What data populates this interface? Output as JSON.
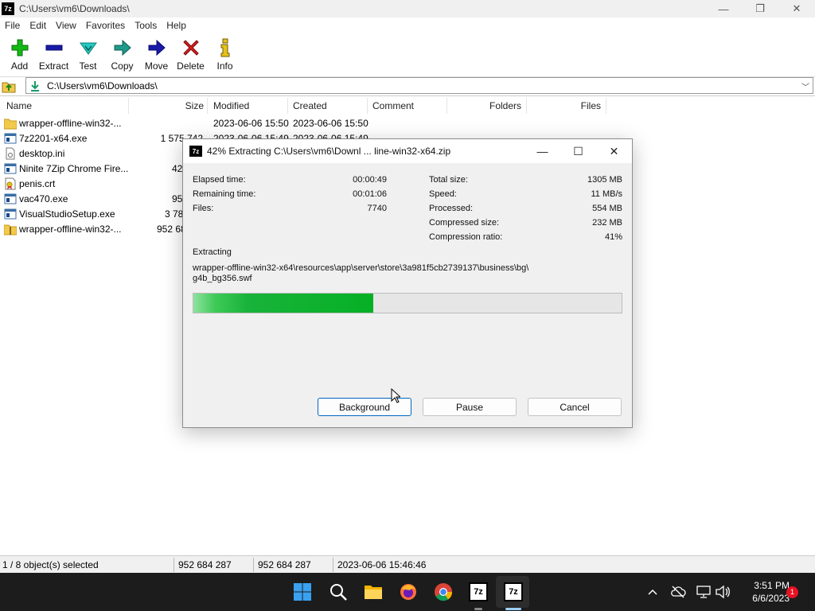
{
  "window": {
    "title": "C:\\Users\\vm6\\Downloads\\",
    "app_icon": "7z",
    "minimize": "—",
    "maximize": "❐",
    "close": "✕"
  },
  "menu": [
    "File",
    "Edit",
    "View",
    "Favorites",
    "Tools",
    "Help"
  ],
  "toolbar": {
    "add": "Add",
    "extract": "Extract",
    "test": "Test",
    "copy": "Copy",
    "move": "Move",
    "delete": "Delete",
    "info": "Info"
  },
  "address": {
    "path": "C:\\Users\\vm6\\Downloads\\"
  },
  "columns": {
    "name": "Name",
    "size": "Size",
    "modified": "Modified",
    "created": "Created",
    "comment": "Comment",
    "folders": "Folders",
    "files": "Files"
  },
  "files": [
    {
      "name": "wrapper-offline-win32-...",
      "size": "",
      "modified": "2023-06-06 15:50",
      "created": "2023-06-06 15:50",
      "icon": "folder-icon"
    },
    {
      "name": "7z2201-x64.exe",
      "size": "1 575 742",
      "modified": "2023-06-06 15:49",
      "created": "2023-06-06 15:49",
      "icon": "exe-icon"
    },
    {
      "name": "desktop.ini",
      "size": "",
      "modified": "",
      "created": "",
      "icon": "ini-icon"
    },
    {
      "name": "Ninite 7Zip Chrome Fire...",
      "size": "42",
      "modified": "",
      "created": "",
      "icon": "exe-icon"
    },
    {
      "name": "penis.crt",
      "size": "",
      "modified": "",
      "created": "",
      "icon": "certificate-icon"
    },
    {
      "name": "vac470.exe",
      "size": "95",
      "modified": "",
      "created": "",
      "icon": "exe-icon"
    },
    {
      "name": "VisualStudioSetup.exe",
      "size": "3 78",
      "modified": "",
      "created": "",
      "icon": "exe-icon"
    },
    {
      "name": "wrapper-offline-win32-...",
      "size": "952 68",
      "modified": "",
      "created": "",
      "icon": "zip-folder-icon"
    }
  ],
  "status": {
    "selection": "1 / 8 object(s) selected",
    "size1": "952 684 287",
    "size2": "952 684 287",
    "date": "2023-06-06 15:46:46"
  },
  "dialog": {
    "title": "42% Extracting C:\\Users\\vm6\\Downl ... line-win32-x64.zip",
    "app_icon": "7z",
    "stats_left": [
      {
        "label": "Elapsed time:",
        "value": "00:00:49"
      },
      {
        "label": "Remaining time:",
        "value": "00:01:06"
      },
      {
        "label": "Files:",
        "value": "7740"
      }
    ],
    "stats_right": [
      {
        "label": "Total size:",
        "value": "1305 MB"
      },
      {
        "label": "Speed:",
        "value": "11 MB/s"
      },
      {
        "label": "Processed:",
        "value": "554 MB"
      },
      {
        "label": "Compressed size:",
        "value": "232 MB"
      },
      {
        "label": "Compression ratio:",
        "value": "41%"
      }
    ],
    "extracting_label": "Extracting",
    "current_file_line1": "wrapper-offline-win32-x64\\resources\\app\\server\\store\\3a981f5cb2739137\\business\\bg\\",
    "current_file_line2": "g4b_bg356.swf",
    "progress_percent": 42,
    "buttons": {
      "background": "Background",
      "pause": "Pause",
      "cancel": "Cancel"
    },
    "minimize": "—",
    "maximize": "☐",
    "close": "✕"
  },
  "taskbar": {
    "time": "3:51 PM",
    "date": "6/6/2023",
    "notifications": "1",
    "app_7z_label": "7z"
  },
  "colors": {
    "progress": "#06b025",
    "taskbar": "#1c1c1c",
    "accent": "#0067c0"
  }
}
